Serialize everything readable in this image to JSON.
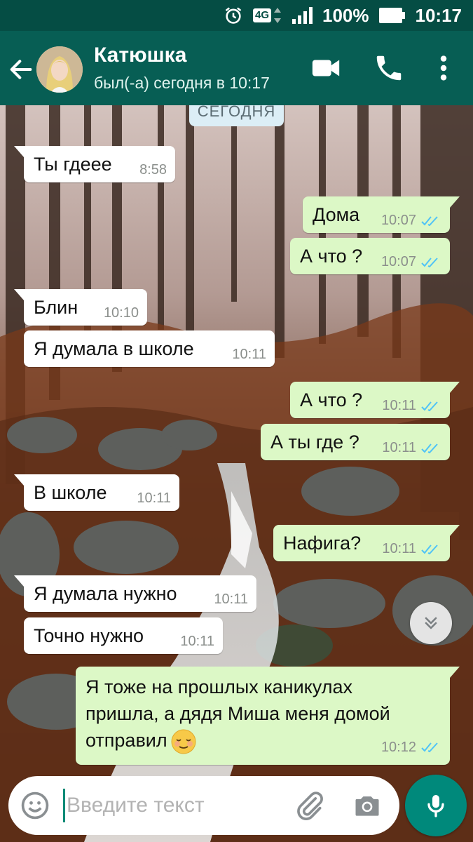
{
  "statusbar": {
    "network": "4G",
    "battery": "100%",
    "time": "10:17"
  },
  "header": {
    "contact_name": "Катюшка",
    "contact_status": "был(-а) сегодня в 10:17"
  },
  "chat": {
    "date_chip": "СЕГОДНЯ",
    "messages": [
      {
        "dir": "in",
        "text": "Ты гдеее",
        "time": "8:58"
      },
      {
        "dir": "out",
        "text": "Дома",
        "time": "10:07",
        "read": true
      },
      {
        "dir": "out",
        "text": "А что ?",
        "time": "10:07",
        "read": true
      },
      {
        "dir": "in",
        "text": "Блин",
        "time": "10:10"
      },
      {
        "dir": "in",
        "text": "Я думала в школе",
        "time": "10:11"
      },
      {
        "dir": "out",
        "text": "А что ?",
        "time": "10:11",
        "read": true
      },
      {
        "dir": "out",
        "text": "А ты где ?",
        "time": "10:11",
        "read": true
      },
      {
        "dir": "in",
        "text": "В школе",
        "time": "10:11"
      },
      {
        "dir": "out",
        "text": "Нафига?",
        "time": "10:11",
        "read": true
      },
      {
        "dir": "in",
        "text": "Я думала нужно",
        "time": "10:11"
      },
      {
        "dir": "in",
        "text": "Точно нужно",
        "time": "10:11"
      },
      {
        "dir": "out",
        "text": "Я тоже на прошлых каникулах пришла, а дядя Миша меня домой отправил",
        "emoji": "relieved-face",
        "time": "10:12",
        "read": true
      }
    ]
  },
  "input": {
    "placeholder": "Введите текст"
  },
  "colors": {
    "header": "#075e54",
    "statusbar": "#054d44",
    "incoming": "#ffffff",
    "outgoing": "#dcf8c6",
    "read_ticks": "#4fc3f7",
    "mic_button": "#00897b"
  }
}
